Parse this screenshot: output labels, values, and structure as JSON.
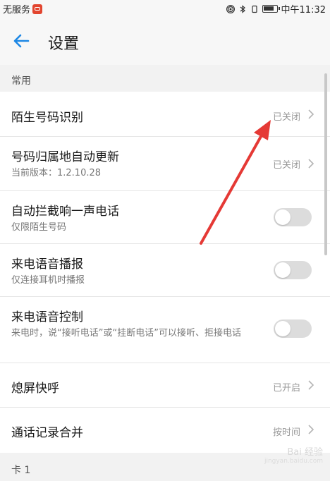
{
  "status_bar": {
    "carrier": "无服务",
    "time": "中午11:32"
  },
  "header": {
    "title": "设置"
  },
  "sections": {
    "common": "常用",
    "card1": "卡 1"
  },
  "rows": {
    "stranger_id": {
      "label": "陌生号码识别",
      "value": "已关闭"
    },
    "location_update": {
      "label": "号码归属地自动更新",
      "sub": "当前版本：1.2.10.28",
      "value": "已关闭"
    },
    "block_one_ring": {
      "label": "自动拦截响一声电话",
      "sub": "仅限陌生号码",
      "on": false
    },
    "voice_announce": {
      "label": "来电语音播报",
      "sub": "仅连接耳机时播报",
      "on": false
    },
    "voice_control": {
      "label": "来电语音控制",
      "sub": "来电时，说“接听电话”或“挂断电话”可以接听、拒接电话",
      "on": false
    },
    "screen_off_call": {
      "label": "熄屏快呼",
      "value": "已开启"
    },
    "merge_logs": {
      "label": "通话记录合并",
      "value": "按时间"
    }
  },
  "watermark": {
    "text": "Bai 经验",
    "sub": "jingyan.baidu.com"
  },
  "colors": {
    "accent": "#1e88e5",
    "arrow": "#e53935"
  }
}
